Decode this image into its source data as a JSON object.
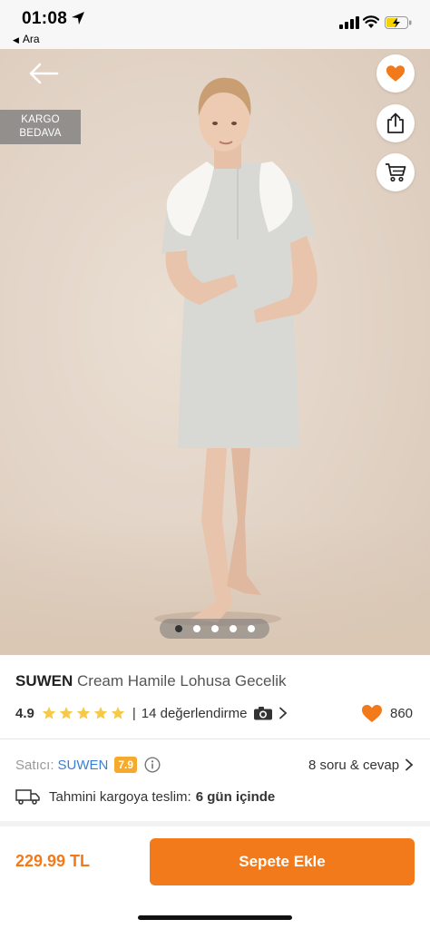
{
  "status_bar": {
    "time": "01:08",
    "back_app": "Ara",
    "icons": [
      "location-arrow-icon",
      "signal-icon",
      "wifi-icon",
      "battery-charging-icon"
    ]
  },
  "hero": {
    "badge_line1": "KARGO",
    "badge_line2": "BEDAVA",
    "image_count": 5,
    "active_image_index": 0,
    "icons": [
      "back-arrow-icon",
      "heart-icon",
      "share-icon",
      "cart-icon"
    ]
  },
  "product": {
    "brand": "SUWEN",
    "name": "Cream Hamile Lohusa Gecelik",
    "rating": "4.9",
    "star_count": 5,
    "reviews": "14 değerlendirme",
    "favorites": "860"
  },
  "seller": {
    "label": "Satıcı:",
    "name": "SUWEN",
    "score": "7.9",
    "qa": "8 soru & cevap"
  },
  "delivery": {
    "label": "Tahmini kargoya teslim:",
    "value": "6 gün içinde"
  },
  "footer": {
    "price": "229.99 TL",
    "add_to_cart": "Sepete Ekle"
  },
  "colors": {
    "accent": "#f27a1a",
    "seller_link": "#3b7fd4",
    "score_badge": "#f7a92c",
    "star": "#f7c948"
  }
}
